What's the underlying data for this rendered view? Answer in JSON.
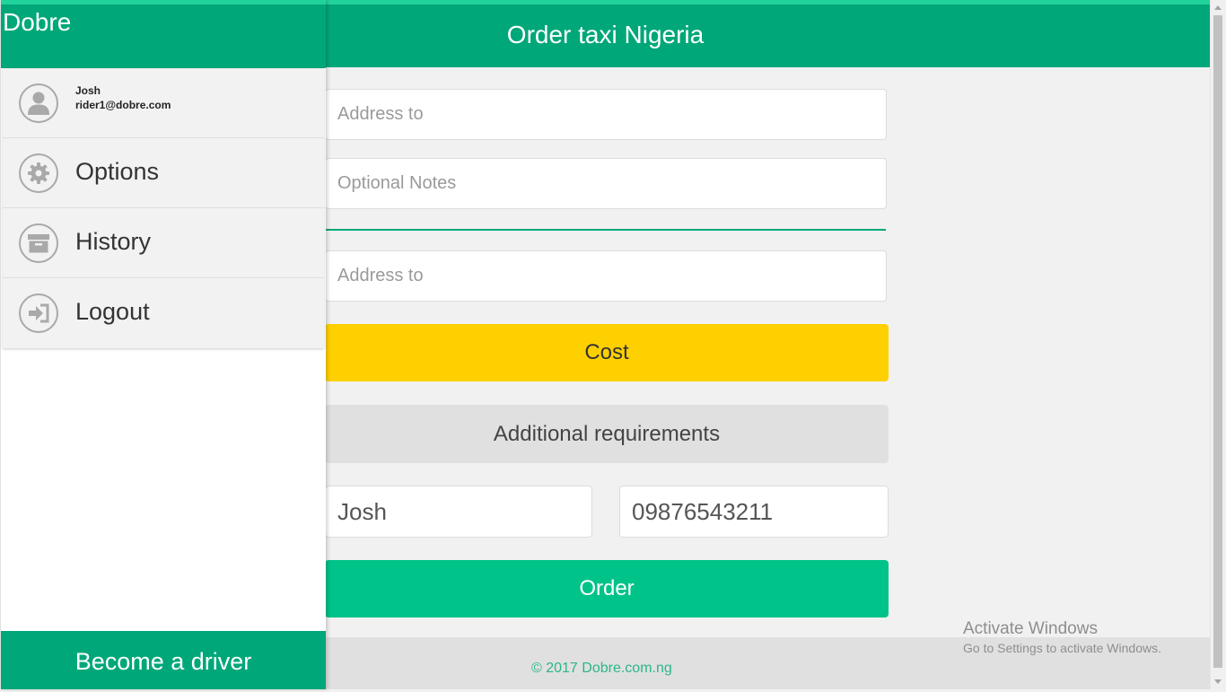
{
  "header": {
    "title": "Order taxi Nigeria"
  },
  "form": {
    "address_to_1": {
      "placeholder": "Address to",
      "value": ""
    },
    "notes": {
      "placeholder": "Optional Notes",
      "value": ""
    },
    "address_to_2": {
      "placeholder": "Address to",
      "value": ""
    },
    "cost_label": "Cost",
    "additional_label": "Additional requirements",
    "name": {
      "value": "Josh"
    },
    "phone": {
      "value": "09876543211"
    },
    "order_label": "Order"
  },
  "footer": {
    "text": "© 2017 Dobre.com.ng"
  },
  "watermark": {
    "title": "Activate Windows",
    "subtitle": "Go to Settings to activate Windows."
  },
  "drawer": {
    "brand": "Dobre",
    "user": {
      "name": "Josh",
      "email": "rider1@dobre.com",
      "icon": "user-icon"
    },
    "items": [
      {
        "label": "Options",
        "icon": "gear-icon"
      },
      {
        "label": "History",
        "icon": "archive-icon"
      },
      {
        "label": "Logout",
        "icon": "logout-icon"
      }
    ],
    "become_driver": "Become a driver"
  },
  "colors": {
    "primary": "#00a779",
    "accent": "#21d39a",
    "cost_button": "#ffd000",
    "order_button": "#00c389"
  }
}
